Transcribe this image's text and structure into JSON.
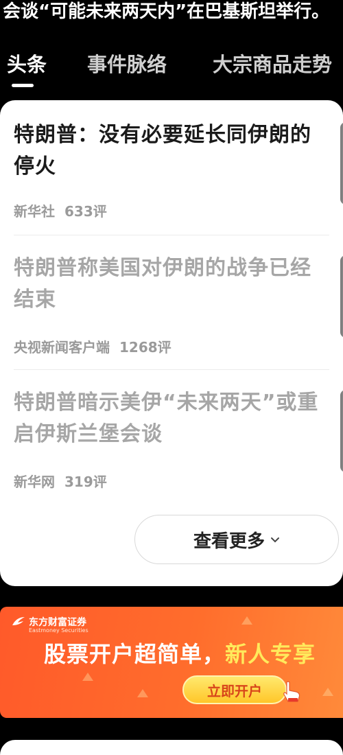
{
  "ticker": {
    "text": "会谈“可能未来两天内”在巴基斯坦举行。"
  },
  "tabs": [
    {
      "label": "头条",
      "active": true
    },
    {
      "label": "事件脉络",
      "active": false
    },
    {
      "label": "大宗商品走势",
      "active": false
    }
  ],
  "news": [
    {
      "title": "特朗普：没有必要延长同伊朗的停火",
      "source": "新华社",
      "comments": "633评"
    },
    {
      "title": "特朗普称美国对伊朗的战争已经结束",
      "source": "央视新闻客户端",
      "comments": "1268评"
    },
    {
      "title": "特朗普暗示美伊“未来两天”或重启伊斯兰堡会谈",
      "source": "新华网",
      "comments": "319评"
    }
  ],
  "more_button": {
    "label": "查看更多",
    "icon": "chevron-down-icon"
  },
  "ad": {
    "brand": "东方财富证券",
    "brand_en": "Eastmoney Securities",
    "headline_main": "股票开户超简单，",
    "headline_highlight": "新人专享",
    "cta_label": "立即开户",
    "colors": {
      "bg": "#ff5a2a",
      "highlight": "#ffea5c",
      "cta": "#ffd23f"
    }
  }
}
